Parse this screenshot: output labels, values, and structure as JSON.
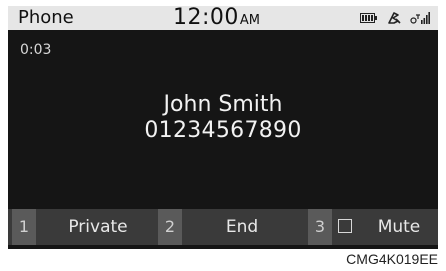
{
  "status_bar": {
    "app_title": "Phone",
    "time": "12:00",
    "ampm": "AM",
    "icons": [
      "battery-icon",
      "bluetooth-icon",
      "signal-icon"
    ]
  },
  "call": {
    "timer": "0:03",
    "caller_name": "John Smith",
    "caller_number": "01234567890"
  },
  "softkeys": [
    {
      "number": "1",
      "label": "Private"
    },
    {
      "number": "2",
      "label": "End"
    },
    {
      "number": "3",
      "label": "Mute"
    }
  ],
  "caption": "CMG4K019EE"
}
